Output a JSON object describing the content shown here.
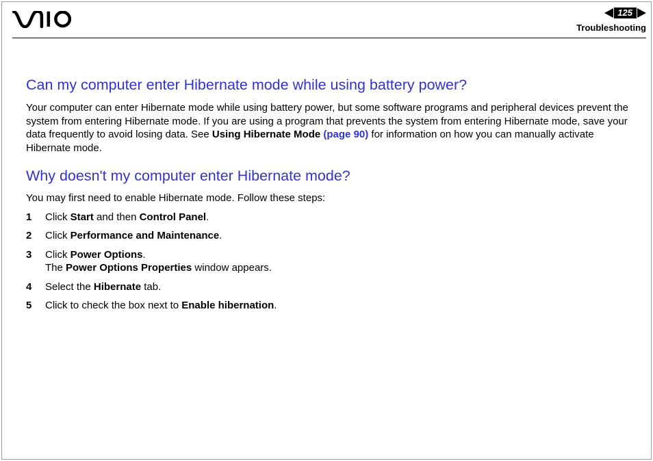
{
  "header": {
    "logo_alt": "VAIO",
    "page_number": "125",
    "section_link": "Troubleshooting"
  },
  "faq1": {
    "heading": "Can my computer enter Hibernate mode while using battery power?",
    "body_pre": "Your computer can enter Hibernate mode while using battery power, but some software programs and peripheral devices prevent the system from entering Hibernate mode. If you are using a program that prevents the system from entering Hibernate mode, save your data frequently to avoid losing data. See ",
    "body_bold": "Using Hibernate Mode ",
    "body_link": "(page 90)",
    "body_post": " for information on how you can manually activate Hibernate mode."
  },
  "faq2": {
    "heading": "Why doesn't my computer enter Hibernate mode?",
    "intro": "You may first need to enable Hibernate mode. Follow these steps:",
    "steps": {
      "s1_a": "Click ",
      "s1_b": "Start",
      "s1_c": " and then ",
      "s1_d": "Control Panel",
      "s1_e": ".",
      "s2_a": "Click ",
      "s2_b": "Performance and Maintenance",
      "s2_c": ".",
      "s3_a": "Click ",
      "s3_b": "Power Options",
      "s3_c": ".",
      "s3_d": "The ",
      "s3_e": "Power Options Properties",
      "s3_f": " window appears.",
      "s4_a": "Select the ",
      "s4_b": "Hibernate",
      "s4_c": " tab.",
      "s5_a": "Click to check the box next to ",
      "s5_b": "Enable hibernation",
      "s5_c": "."
    }
  }
}
